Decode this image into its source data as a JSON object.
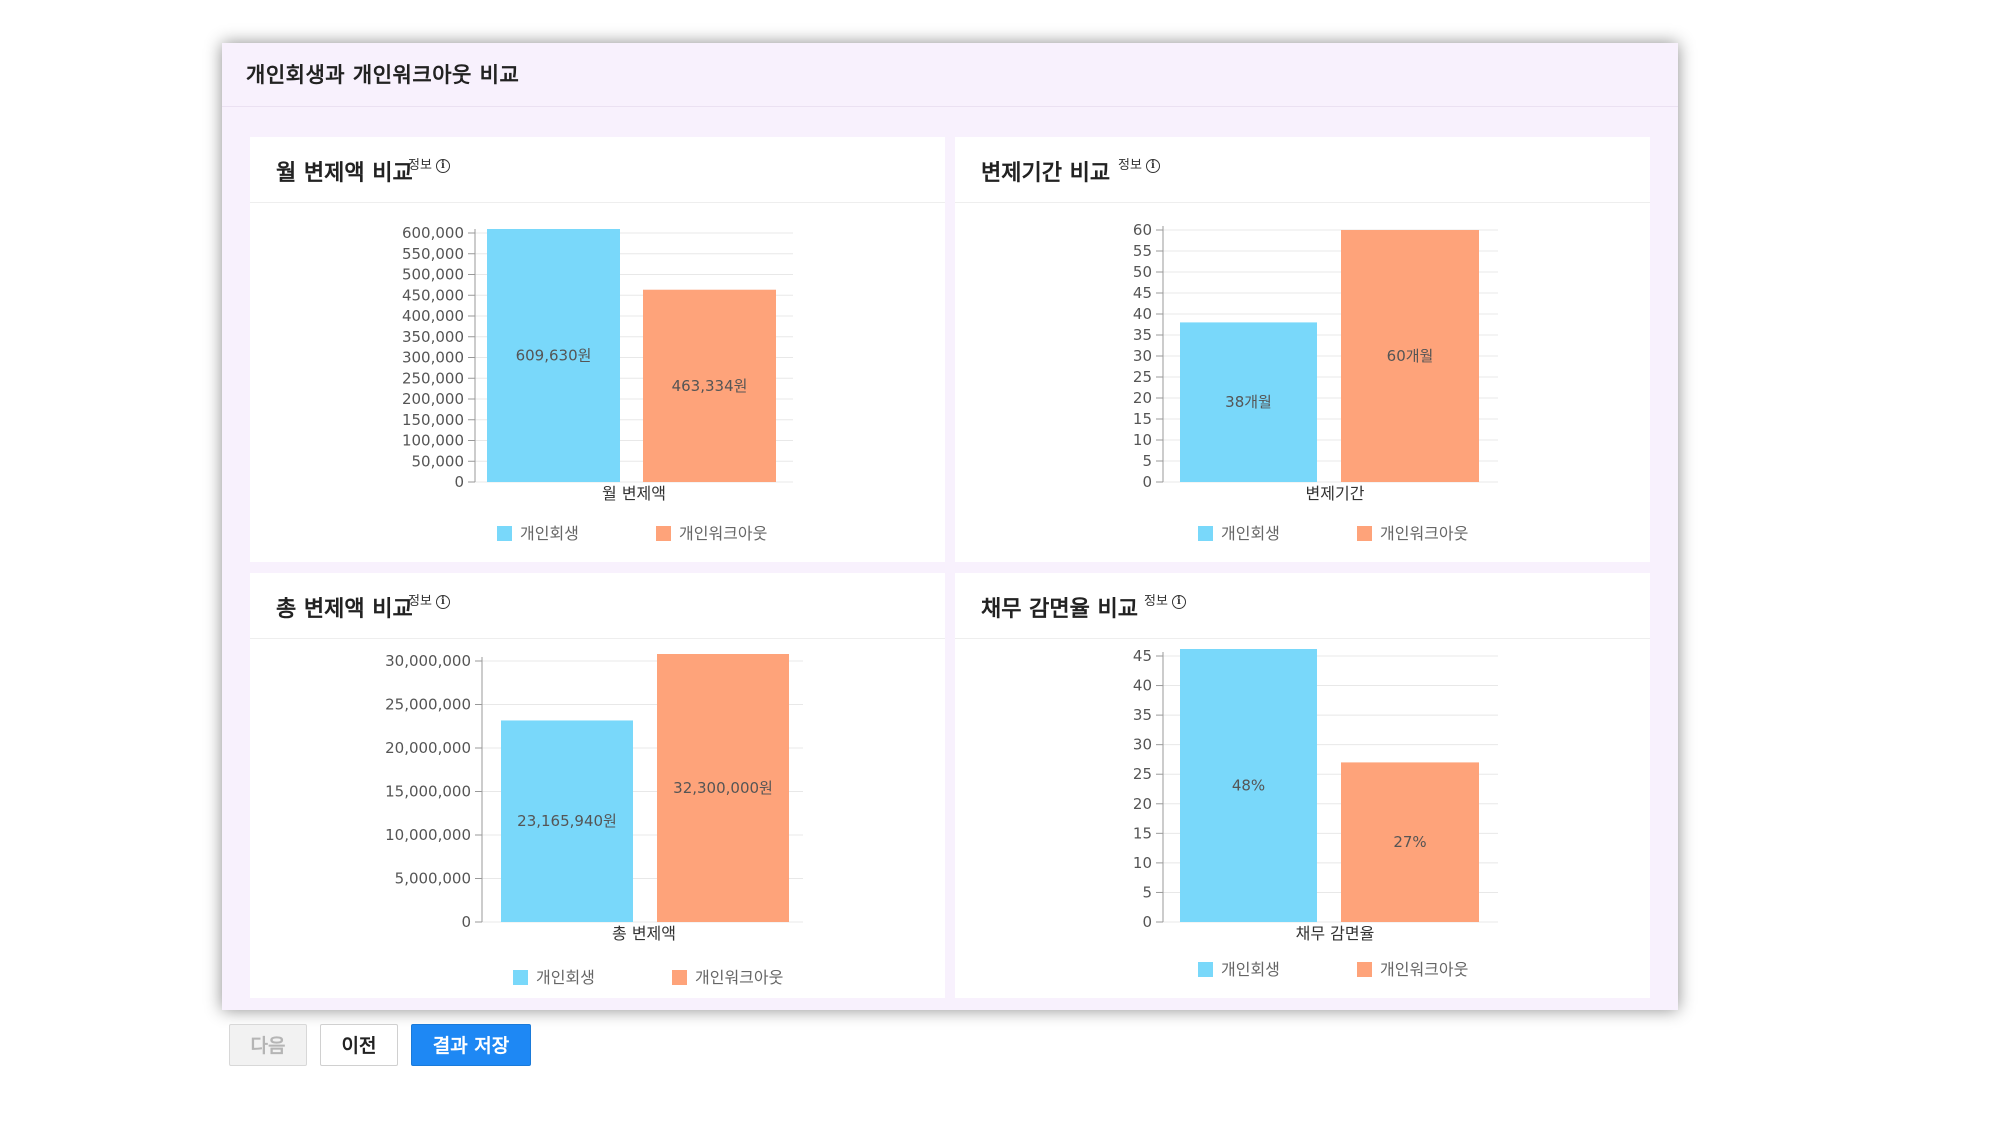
{
  "page": {
    "title": "개인회생과 개인워크아웃 비교"
  },
  "info_label": "정보",
  "info_icon": "info-circle-icon",
  "colors": {
    "series1": "#79d8fa",
    "series2": "#fea37a",
    "grid": "#e8e8e8",
    "axis": "#666666"
  },
  "buttons": {
    "next": "다음",
    "prev": "이전",
    "save": "결과 저장"
  },
  "chart_data": [
    {
      "id": "monthly",
      "title": "월 변제액 비교",
      "type": "bar",
      "categories": [
        "월 변제액"
      ],
      "xlabel": "월 변제액",
      "ylim": [
        0,
        600000
      ],
      "ytick_step": 50000,
      "ytick_labels": [
        "0",
        "50,000",
        "100,000",
        "150,000",
        "200,000",
        "250,000",
        "300,000",
        "350,000",
        "400,000",
        "450,000",
        "500,000",
        "550,000",
        "600,000"
      ],
      "grid": true,
      "legend_position": "bottom",
      "series": [
        {
          "name": "개인회생",
          "values": [
            609630
          ],
          "label": "609,630원"
        },
        {
          "name": "개인워크아웃",
          "values": [
            463334
          ],
          "label": "463,334원"
        }
      ]
    },
    {
      "id": "period",
      "title": "변제기간 비교",
      "type": "bar",
      "categories": [
        "변제기간"
      ],
      "xlabel": "변제기간",
      "ylim": [
        0,
        60
      ],
      "ytick_step": 5,
      "ytick_labels": [
        "0",
        "5",
        "10",
        "15",
        "20",
        "25",
        "30",
        "35",
        "40",
        "45",
        "50",
        "55",
        "60"
      ],
      "grid": true,
      "legend_position": "bottom",
      "series": [
        {
          "name": "개인회생",
          "values": [
            38
          ],
          "label": "38개월"
        },
        {
          "name": "개인워크아웃",
          "values": [
            60
          ],
          "label": "60개월"
        }
      ]
    },
    {
      "id": "total",
      "title": "총 변제액 비교",
      "type": "bar",
      "categories": [
        "총 변제액"
      ],
      "xlabel": "총 변제액",
      "ylim": [
        0,
        30000000
      ],
      "ytick_step": 5000000,
      "ytick_labels": [
        "0",
        "5,000,000",
        "10,000,000",
        "15,000,000",
        "20,000,000",
        "25,000,000",
        "30,000,000"
      ],
      "grid": true,
      "legend_position": "bottom",
      "series": [
        {
          "name": "개인회생",
          "values": [
            23165940
          ],
          "label": "23,165,940원"
        },
        {
          "name": "개인워크아웃",
          "values": [
            32300000
          ],
          "label": "32,300,000원"
        }
      ]
    },
    {
      "id": "reduction",
      "title": "채무 감면율 비교",
      "type": "bar",
      "categories": [
        "채무 감면율"
      ],
      "xlabel": "채무 감면율",
      "ylim": [
        0,
        45
      ],
      "ytick_step": 5,
      "ytick_labels": [
        "0",
        "5",
        "10",
        "15",
        "20",
        "25",
        "30",
        "35",
        "40",
        "45"
      ],
      "grid": true,
      "legend_position": "bottom",
      "series": [
        {
          "name": "개인회생",
          "values": [
            48
          ],
          "label": "48%"
        },
        {
          "name": "개인워크아웃",
          "values": [
            27
          ],
          "label": "27%"
        }
      ]
    }
  ]
}
